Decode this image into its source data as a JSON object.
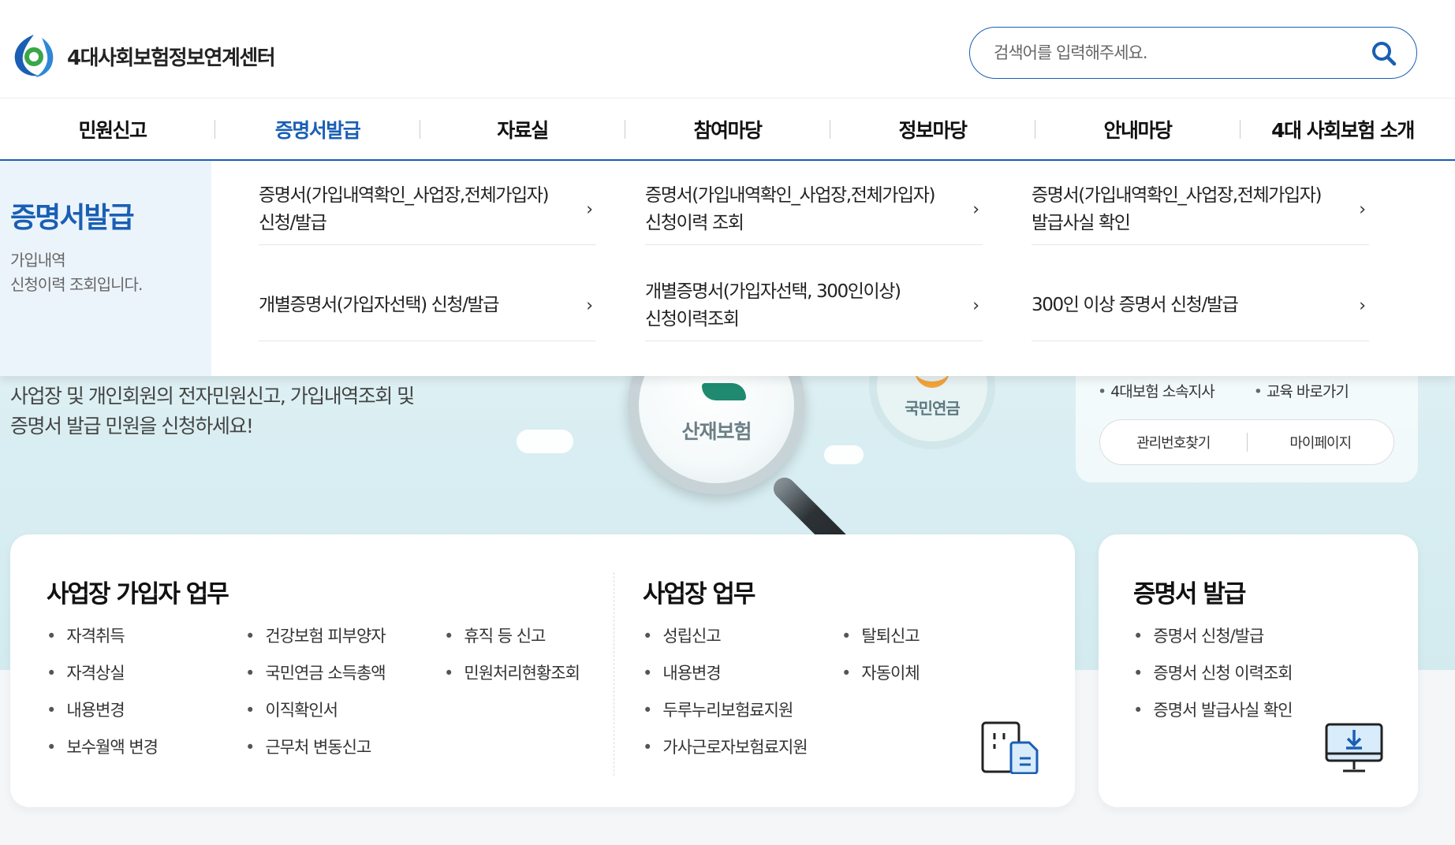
{
  "header": {
    "logo_text": "4대사회보험정보연계센터",
    "search_placeholder": "검색어를 입력해주세요."
  },
  "gnb": [
    {
      "label": "민원신고",
      "active": false
    },
    {
      "label": "증명서발급",
      "active": true
    },
    {
      "label": "자료실",
      "active": false
    },
    {
      "label": "참여마당",
      "active": false
    },
    {
      "label": "정보마당",
      "active": false
    },
    {
      "label": "안내마당",
      "active": false
    },
    {
      "label": "4대 사회보험 소개",
      "active": false
    }
  ],
  "mega": {
    "title": "증명서발급",
    "desc_line1": "가입내역",
    "desc_line2": "신청이력 조회입니다.",
    "items": [
      {
        "line1": "증명서(가입내역확인_사업장,전체가입자)",
        "line2": "신청/발급"
      },
      {
        "line1": "증명서(가입내역확인_사업장,전체가입자)",
        "line2": "신청이력 조회"
      },
      {
        "line1": "증명서(가입내역확인_사업장,전체가입자)",
        "line2": "발급사실 확인"
      },
      {
        "line1": "개별증명서(가입자선택) 신청/발급",
        "line2": ""
      },
      {
        "line1": "개별증명서(가입자선택, 300인이상)",
        "line2": "신청이력조회"
      },
      {
        "line1": "300인 이상 증명서 신청/발급",
        "line2": ""
      }
    ],
    "arrow": "›"
  },
  "hero": {
    "text_line1": "사업장 및 개인회원의 전자민원신고, 가입내역조회 및",
    "text_line2": "증명서 발급 민원을 신청하세요!",
    "mag_label": "산재보험",
    "pension_label": "국민연금",
    "links": [
      "4대보험 소속지사",
      "교육 바로가기"
    ],
    "buttons": [
      "관리번호찾기",
      "마이페이지"
    ]
  },
  "cards": {
    "subscriber": {
      "title": "사업장 가입자 업무",
      "col1": [
        "자격취득",
        "자격상실",
        "내용변경",
        "보수월액 변경"
      ],
      "col2": [
        "건강보험 피부양자",
        "국민연금 소득총액",
        "이직확인서",
        "근무처 변동신고"
      ],
      "col3": [
        "휴직 등 신고",
        "민원처리현황조회"
      ]
    },
    "business": {
      "title": "사업장 업무",
      "col1": [
        "성립신고",
        "내용변경",
        "두루누리보험료지원",
        "가사근로자보험료지원"
      ],
      "col2": [
        "탈퇴신고",
        "자동이체"
      ]
    },
    "cert": {
      "title": "증명서 발급",
      "items": [
        "증명서 신청/발급",
        "증명서 신청 이력조회",
        "증명서 발급사실 확인"
      ]
    }
  },
  "colors": {
    "primary": "#1a5fb4",
    "hero_bg": "#d9eef2",
    "mega_side_bg": "#ecf4fb"
  },
  "icons": {
    "search": "search-icon",
    "building": "building-document-icon",
    "monitor": "monitor-download-icon"
  }
}
